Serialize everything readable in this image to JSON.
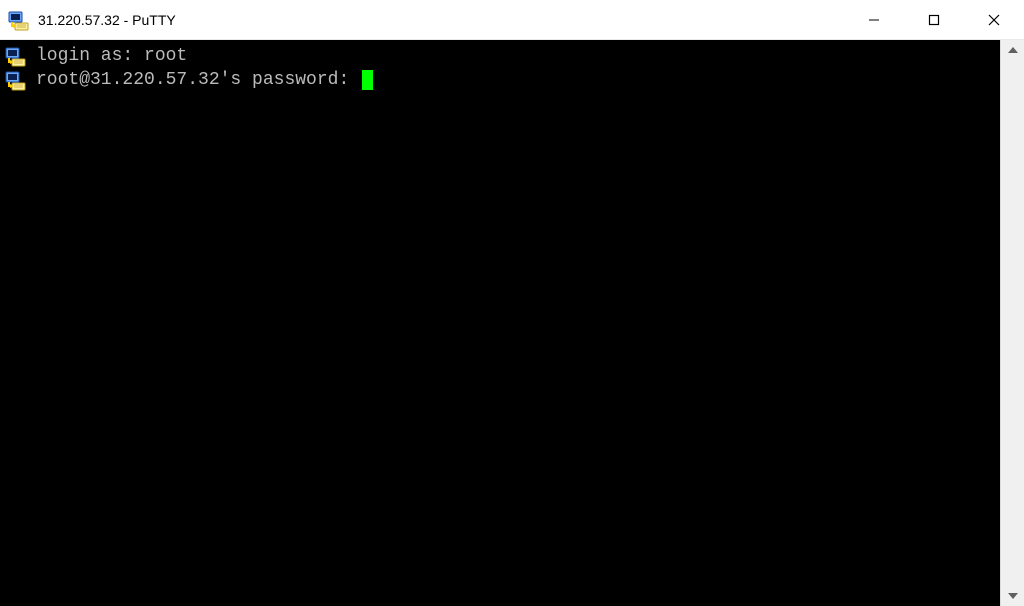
{
  "window": {
    "title": "31.220.57.32 - PuTTY"
  },
  "terminal": {
    "lines": [
      {
        "prompt": "login as: ",
        "value": "root"
      },
      {
        "prompt": "root@31.220.57.32's password: ",
        "value": ""
      }
    ]
  },
  "colors": {
    "cursor": "#00ff00",
    "terminal_bg": "#000000",
    "terminal_fg": "#bbbbbb"
  }
}
